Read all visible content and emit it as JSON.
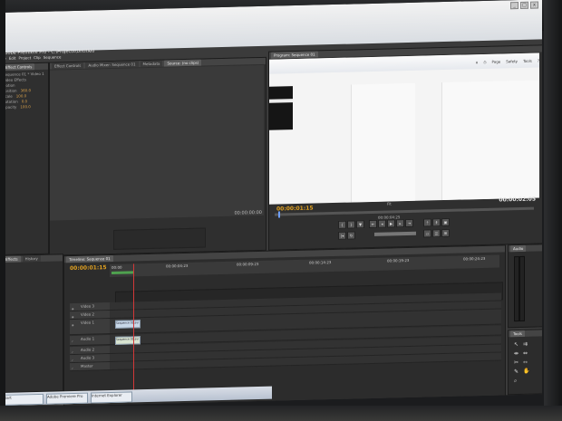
{
  "app": {
    "title": "Adobe Premiere Pro - C:\\Projects\\Untitled"
  },
  "window_controls": {
    "minimize": "_",
    "maximize": "□",
    "close": "x"
  },
  "menubar": [
    "File",
    "Edit",
    "Project",
    "Clip",
    "Sequence",
    "Marker",
    "Title",
    "Window",
    "Help"
  ],
  "effect_controls": {
    "tabs": [
      "Effect Controls",
      "Source"
    ],
    "lines": [
      {
        "label": "Sequence 01 * Video 1",
        "value": ""
      },
      {
        "label": "Video Effects",
        "value": ""
      },
      {
        "label": "Motion",
        "value": ""
      },
      {
        "label": "Position",
        "value": "360.0"
      },
      {
        "label": "Scale",
        "value": "100.0"
      },
      {
        "label": "Rotation",
        "value": "0.0"
      },
      {
        "label": "Opacity",
        "value": "100.0"
      }
    ]
  },
  "source_panel": {
    "tabs": [
      "Effect Controls",
      "Audio Mixer: Sequence 01",
      "Metadata",
      "Source: (no clips)"
    ],
    "timecode": "00:00:00:00"
  },
  "program_panel": {
    "tabs": [
      "Program: Sequence 01"
    ],
    "timecode_current": "00:00:01:15",
    "timecode_duration": "00:00:02:05",
    "fit_label": "Fit",
    "ruler_label": "00:00:04:25"
  },
  "ie_toolbar": [
    "Page",
    "Safety",
    "Tools"
  ],
  "timeline": {
    "tabs": [
      "Timeline: Sequence 01"
    ],
    "timecode": "00:00:01:15",
    "ruler_ticks": [
      "00:00",
      "00:00:04:23",
      "00:00:09:23",
      "00:00:14:23",
      "00:00:19:23",
      "00:00:24:23"
    ],
    "video_tracks": [
      "Video 3",
      "Video 2",
      "Video 1"
    ],
    "audio_tracks": [
      "Audio 1",
      "Audio 2",
      "Audio 3",
      "Master"
    ],
    "clip_video": "Sequence 01.avi",
    "clip_audio": "Sequence 01.avi"
  },
  "left_lower": {
    "tabs": [
      "Effects",
      "History"
    ]
  },
  "audio_panel": {
    "title": "Audio"
  },
  "tools_panel": {
    "title": "Tools"
  },
  "taskbar": {
    "items": [
      "Start",
      "Adobe Premiere Pro",
      "Internet Explorer"
    ]
  },
  "colors": {
    "timecode": "#e0a020",
    "playhead": "#d13838",
    "work_area": "#4fa14f"
  }
}
